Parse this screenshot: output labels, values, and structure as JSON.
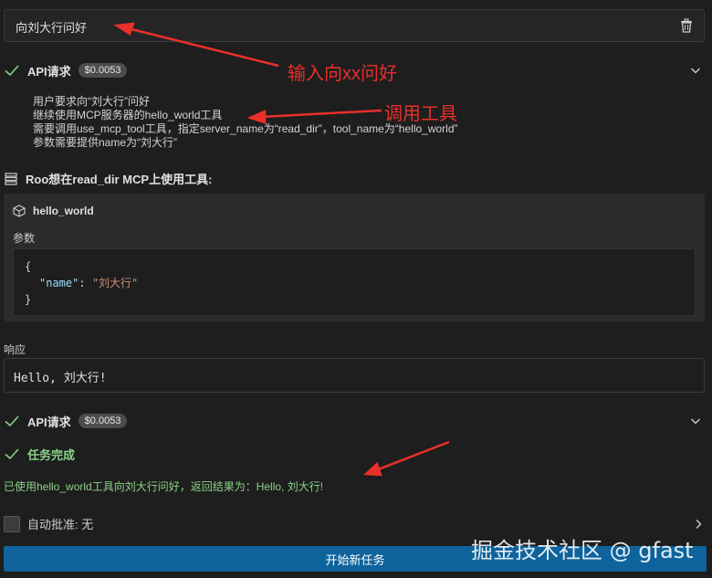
{
  "task": {
    "text": "向刘大行问好"
  },
  "api_request_1": {
    "label": "API请求",
    "cost": "$0.0053"
  },
  "reasoning": {
    "lines": [
      "用户要求向“刘大行”问好",
      "继续使用MCP服务器的hello_world工具",
      "需要调用use_mcp_tool工具，指定server_name为“read_dir”，tool_name为“hello_world”",
      "参数需要提供name为“刘大行”"
    ]
  },
  "mcp": {
    "title": "Roo想在read_dir MCP上使用工具:",
    "tool_name": "hello_world",
    "params_label": "参数",
    "code": {
      "open": "{",
      "key": "\"name\"",
      "colon": ": ",
      "value": "\"刘大行\"",
      "close": "}"
    }
  },
  "response": {
    "label": "响应",
    "text": "Hello, 刘大行!"
  },
  "api_request_2": {
    "label": "API请求",
    "cost": "$0.0053"
  },
  "completion": {
    "title": "任务完成",
    "text": "已使用hello_world工具向刘大行问好，返回结果为：Hello, 刘大行!"
  },
  "auto_approve": {
    "label": "自动批准:",
    "value": "无"
  },
  "start_button": {
    "label": "开始新任务"
  },
  "watermark": "掘金技术社区 @ gfast",
  "annotations": {
    "a1": "输入向xx问好",
    "a2": "调用工具"
  },
  "colors": {
    "accent": "#0e639c",
    "success": "#89d185",
    "annotation": "#e8302a"
  }
}
